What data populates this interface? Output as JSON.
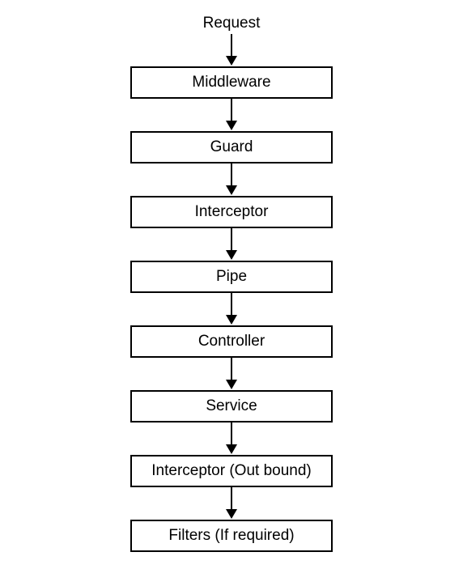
{
  "diagram": {
    "start": "Request",
    "steps": [
      "Middleware",
      "Guard",
      "Interceptor",
      "Pipe",
      "Controller",
      "Service",
      "Interceptor (Out bound)",
      "Filters (If required)"
    ]
  }
}
